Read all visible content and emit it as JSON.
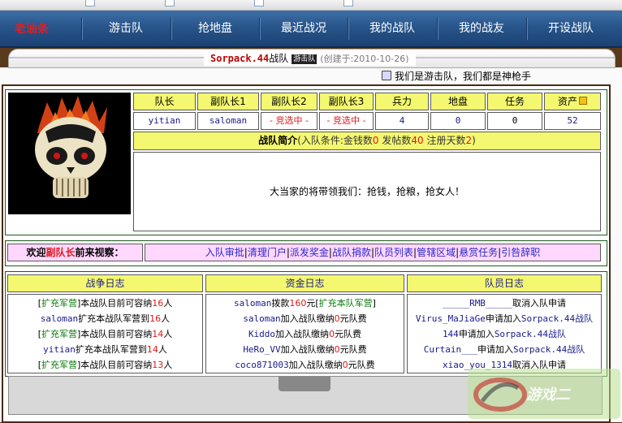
{
  "nav": {
    "brand": "老油条",
    "items": [
      "游击队",
      "抢地盘",
      "最近战况",
      "我的战队",
      "我的战友",
      "开设战队"
    ]
  },
  "header": {
    "team_name": "Sorpack.44",
    "team_suffix": "战队",
    "team_tag": "游击队",
    "created": "(创建于:2010-10-26)"
  },
  "slogan": "我们是游击队，我们都是神枪手",
  "stats": {
    "headers": [
      "队长",
      "副队长1",
      "副队长2",
      "副队长3",
      "兵力",
      "地盘",
      "任务",
      "资产"
    ],
    "values": [
      "yitian",
      "saloman",
      "- 竞选中 -",
      "- 竞选中 -",
      "4",
      "0",
      "0",
      "52"
    ]
  },
  "intro": {
    "title": "战队简介",
    "cond_prefix": "(入队条件:金钱数",
    "cond_money": "0",
    "cond_posts_label": " 发帖数",
    "cond_posts": "40",
    "cond_days_label": " 注册天数",
    "cond_days": "2",
    "cond_suffix": ")",
    "text": "大当家的将带领我们：抢钱，抢粮，抢女人！"
  },
  "welcome": {
    "prefix": "欢迎",
    "role": "副队长",
    "suffix": "前来视察："
  },
  "actions": [
    "入队审批",
    "清理门户",
    "派发奖金",
    "战队捐款",
    "队员列表",
    "管辖区域",
    "悬赏任务",
    "引咎辞职"
  ],
  "logs": {
    "war": {
      "title": "战争日志",
      "lines": [
        {
          "a": "[",
          "b": "扩充军营",
          "c": "]本战队目前可容纳",
          "d": "16",
          "e": "人"
        },
        {
          "a": "saloman",
          "b": "",
          "c": "扩充本战队军营到",
          "d": "16",
          "e": "人"
        },
        {
          "a": "[",
          "b": "扩充军营",
          "c": "]本战队目前可容纳",
          "d": "14",
          "e": "人"
        },
        {
          "a": "yitian",
          "b": "",
          "c": "扩充本战队军营到",
          "d": "14",
          "e": "人"
        },
        {
          "a": "[",
          "b": "扩充军营",
          "c": "]本战队目前可容纳",
          "d": "13",
          "e": "人"
        }
      ]
    },
    "funds": {
      "title": "资金日志",
      "lines": [
        {
          "a": "saloman",
          "b": "拨款",
          "c": "160",
          "d": "元[",
          "e": "扩充本队军营",
          "f": "]"
        },
        {
          "a": "saloman",
          "b": "加入战队缴纳",
          "c": "0",
          "d": "元队费",
          "e": "",
          "f": ""
        },
        {
          "a": "Kiddo",
          "b": "加入战队缴纳",
          "c": "0",
          "d": "元队费",
          "e": "",
          "f": ""
        },
        {
          "a": "HeRo_VV",
          "b": "加入战队缴纳",
          "c": "0",
          "d": "元队费",
          "e": "",
          "f": ""
        },
        {
          "a": "coco871003",
          "b": "加入战队缴纳",
          "c": "0",
          "d": "元队费",
          "e": "",
          "f": ""
        }
      ]
    },
    "members": {
      "title": "队员日志",
      "lines": [
        {
          "a": "_____RMB_____",
          "b": "取消入队申请",
          "c": ""
        },
        {
          "a": "Virus_MaJiaGe",
          "b": "申请加入",
          "c": "Sorpack.44战队"
        },
        {
          "a": "144",
          "b": "申请加入",
          "c": "Sorpack.44战队"
        },
        {
          "a": "Curtain___",
          "b": "申请加入",
          "c": "Sorpack.44战队"
        },
        {
          "a": "xiao_you_1314",
          "b": "取消入队申请",
          "c": ""
        }
      ]
    }
  },
  "watermark": "游戏二"
}
